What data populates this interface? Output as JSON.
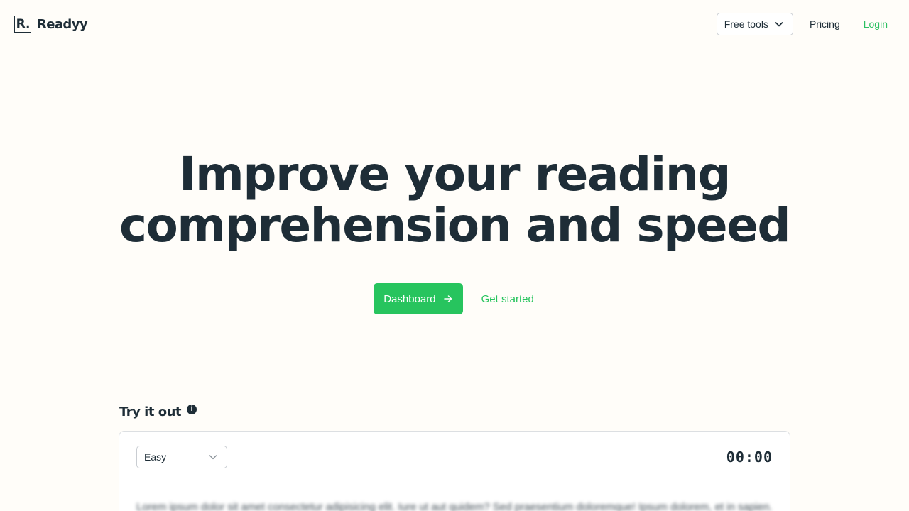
{
  "header": {
    "logo_letter": "R.",
    "brand_name": "Readyy",
    "free_tools_label": "Free tools",
    "pricing_label": "Pricing",
    "login_label": "Login"
  },
  "hero": {
    "title_line1": "Improve your reading",
    "title_line2": "comprehension and speed",
    "dashboard_label": "Dashboard",
    "get_started_label": "Get started"
  },
  "try_it": {
    "title": "Try it out",
    "info_glyph": "i",
    "difficulty_selected": "Easy",
    "timer": "00:00",
    "passage": "Lorem ipsum dolor sit amet consectetur adipisicing elit. Iure ut aut quidem? Sed praesentium doloremque! Ipsum dolorem, et in sapien."
  },
  "colors": {
    "background": "#fffdf9",
    "text": "#1e2d37",
    "accent_green": "#27c45e",
    "border": "#dcdfe2"
  },
  "icons": {
    "dropdown": "chevron-down-icon",
    "dashboard_arrow": "arrow-right-icon",
    "info": "info-icon"
  }
}
